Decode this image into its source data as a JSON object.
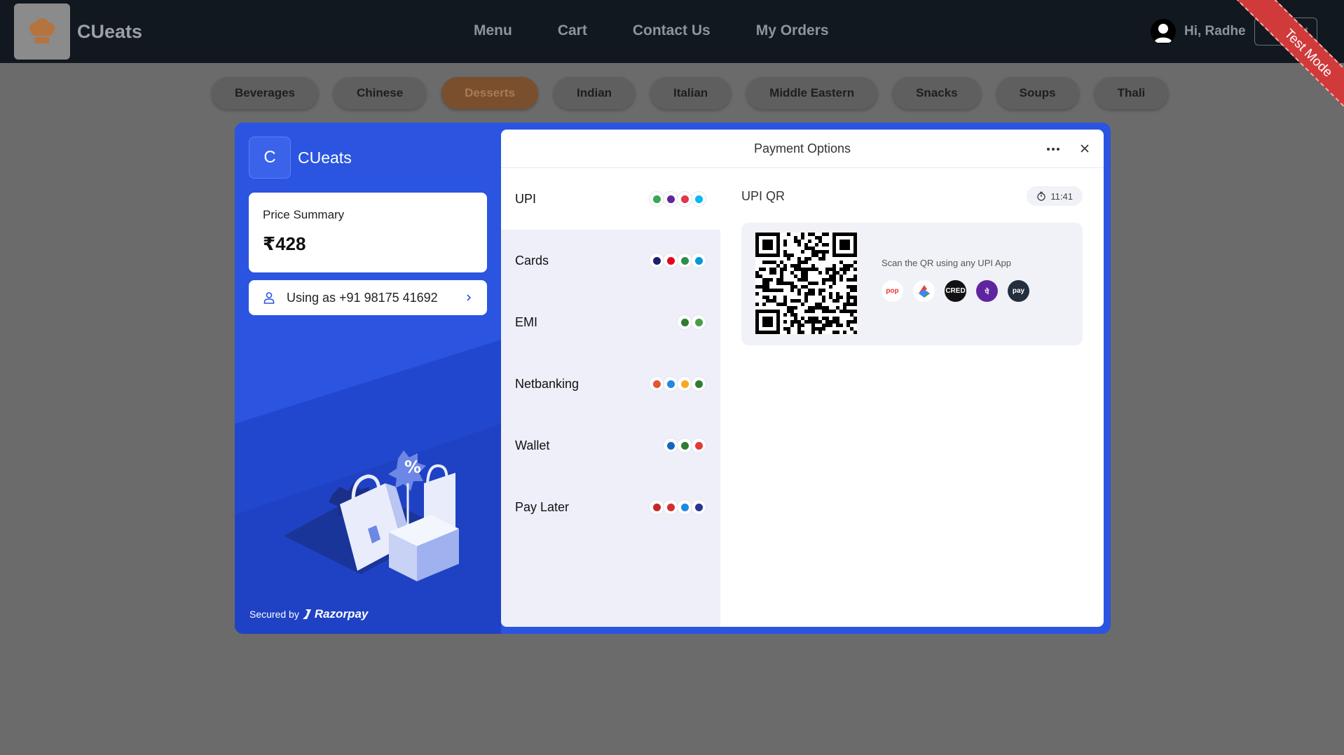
{
  "header": {
    "brand": "CUeats",
    "nav": [
      "Menu",
      "Cart",
      "Contact Us",
      "My Orders"
    ],
    "greeting": "Hi, Radhe",
    "logout_label": "ut",
    "ribbon": "Test Mode"
  },
  "categories": {
    "items": [
      "Beverages",
      "Chinese",
      "Desserts",
      "Indian",
      "Italian",
      "Middle Eastern",
      "Snacks",
      "Soups",
      "Thali"
    ],
    "active": "Desserts"
  },
  "checkout": {
    "merchant_initial": "C",
    "merchant_name": "CUeats",
    "price_label": "Price Summary",
    "price_value": "₹428",
    "user_label": "Using as +91 98175 41692",
    "secured_by": "Secured by",
    "provider": "Razorpay",
    "title": "Payment Options",
    "methods": [
      {
        "label": "UPI",
        "icons": [
          "#34a853",
          "#5f259f",
          "#e23744",
          "#00baf2"
        ]
      },
      {
        "label": "Cards",
        "icons": [
          "#1a1f71",
          "#eb001b",
          "#2d8f4e",
          "#0099df"
        ]
      },
      {
        "label": "EMI",
        "icons": [
          "#2e7d32",
          "#43a047"
        ]
      },
      {
        "label": "Netbanking",
        "icons": [
          "#e4572e",
          "#1e88e5",
          "#f9a825",
          "#2e7d32"
        ]
      },
      {
        "label": "Wallet",
        "icons": [
          "#1565c0",
          "#2e7d32",
          "#e53935"
        ]
      },
      {
        "label": "Pay Later",
        "icons": [
          "#c62828",
          "#d32f2f",
          "#1e88e5",
          "#283593"
        ]
      }
    ],
    "selected_method": "UPI",
    "qr_title": "UPI QR",
    "timer": "11:41",
    "qr_hint": "Scan the QR using any UPI App",
    "apps": [
      {
        "name": "pop",
        "label": "pop",
        "bg": "#ffffff",
        "fg": "#e53935"
      },
      {
        "name": "google-pay",
        "label": "",
        "bg": "#ffffff",
        "fg": "#4285f4"
      },
      {
        "name": "cred",
        "label": "CRED",
        "bg": "#111111",
        "fg": "#ffffff"
      },
      {
        "name": "phonepe",
        "label": "पे",
        "bg": "#5f259f",
        "fg": "#ffffff"
      },
      {
        "name": "amazon-pay",
        "label": "pay",
        "bg": "#232f3e",
        "fg": "#ffffff"
      }
    ]
  }
}
